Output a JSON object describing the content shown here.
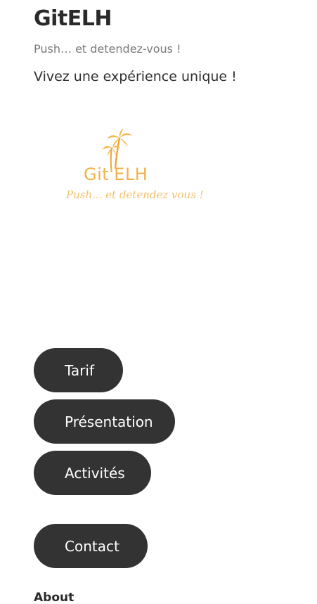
{
  "site": {
    "title": "GitELH",
    "tagline": "Push… et detendez-vous !",
    "lead": "Vivez une expérience unique !"
  },
  "logo": {
    "name": "Git'ELH",
    "script": "Push... et detendez vous !",
    "accent_color": "#f0b24a"
  },
  "nav": {
    "tarif": "Tarif",
    "presentation": "Présentation",
    "activites": "Activités",
    "contact": "Contact"
  },
  "footer": {
    "about_heading": "About"
  },
  "colors": {
    "button_bg": "#333333",
    "button_text": "#ffffff",
    "text": "#2f2f2f",
    "muted": "#7a7a7a"
  }
}
